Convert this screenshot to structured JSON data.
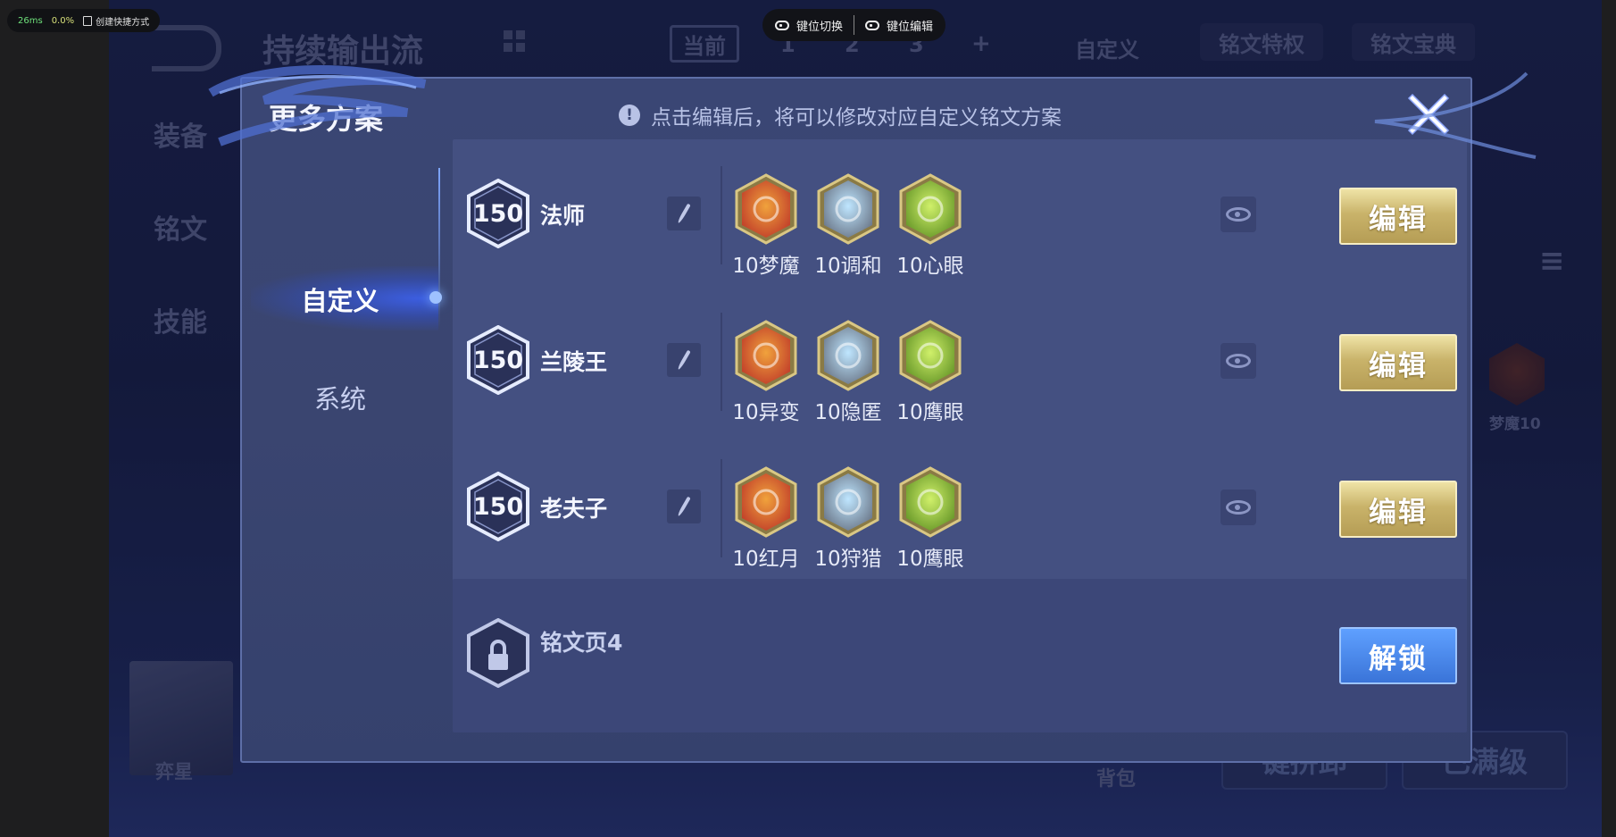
{
  "perf": {
    "latency": "26ms",
    "percent": "0.0%",
    "shortcut_label": "创建快捷方式"
  },
  "keybar": {
    "switch_label": "键位切换",
    "edit_label": "键位编辑"
  },
  "background": {
    "page_title": "持续输出流",
    "current_label": "当前",
    "slots": [
      "1",
      "2",
      "3",
      "+"
    ],
    "custom_label": "自定义",
    "privilege_label": "铭文特权",
    "treasure_label": "铭文宝典",
    "nav": [
      "装备",
      "铭文",
      "技能"
    ],
    "hero_name": "弈星",
    "bag_label": "背包",
    "bottom_btn1": "键拼卸",
    "bottom_btn2": "已满级",
    "side_rune_label": "梦魔10"
  },
  "modal": {
    "title": "更多方案",
    "hint": "点击编辑后，将可以修改对应自定义铭文方案",
    "tabs": [
      "自定义",
      "系统"
    ],
    "rows": [
      {
        "level": "150",
        "name": "法师",
        "runes": [
          {
            "label": "10梦魔",
            "color": "#c2402a",
            "accent": "#f0a23c"
          },
          {
            "label": "10调和",
            "color": "#6d7a8c",
            "accent": "#bfe6ff"
          },
          {
            "label": "10心眼",
            "color": "#6a9a2a",
            "accent": "#d0f06a"
          }
        ],
        "action": "编辑"
      },
      {
        "level": "150",
        "name": "兰陵王",
        "runes": [
          {
            "label": "10异变",
            "color": "#c2402a",
            "accent": "#f0a23c"
          },
          {
            "label": "10隐匿",
            "color": "#6d7a8c",
            "accent": "#bfe6ff"
          },
          {
            "label": "10鹰眼",
            "color": "#6a9a2a",
            "accent": "#d0f06a"
          }
        ],
        "action": "编辑"
      },
      {
        "level": "150",
        "name": "老夫子",
        "runes": [
          {
            "label": "10红月",
            "color": "#c2402a",
            "accent": "#f0a23c"
          },
          {
            "label": "10狩猎",
            "color": "#6d7a8c",
            "accent": "#bfe6ff"
          },
          {
            "label": "10鹰眼",
            "color": "#6a9a2a",
            "accent": "#d0f06a"
          }
        ],
        "action": "编辑"
      }
    ],
    "locked_row": {
      "name": "铭文页4",
      "action": "解锁"
    }
  },
  "colors": {
    "gold": "#d7c27a",
    "panel": "#3a4674",
    "row": "#445081",
    "accent_blue": "#7fb0ff"
  }
}
